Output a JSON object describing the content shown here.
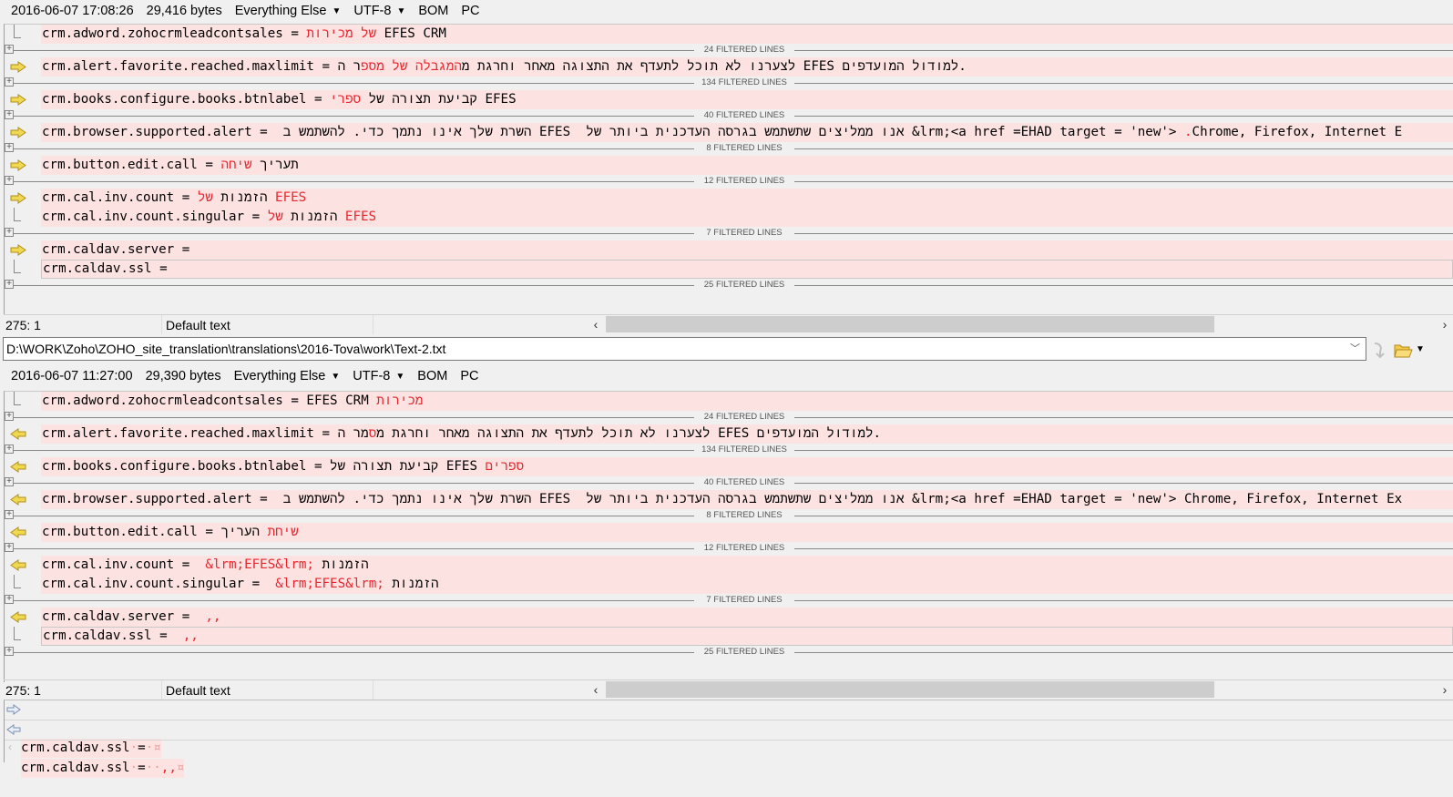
{
  "left_header": {
    "datetime": "2016-06-07 17:08:26",
    "size": "29,416 bytes",
    "format": "Everything Else",
    "encoding": "UTF-8",
    "bom": "BOM",
    "line_ending": "PC"
  },
  "left_panel": [
    {
      "type": "row",
      "arrow": false,
      "parts": [
        {
          "t": "crm.adword.zohocrmleadcontsales = "
        },
        {
          "t": "של מכירות",
          "red": true
        },
        {
          "t": " EFES CRM"
        }
      ]
    },
    {
      "type": "sep",
      "label": "24 FILTERED LINES"
    },
    {
      "type": "row",
      "arrow": true,
      "parts": [
        {
          "t": "crm.alert.favorite.reached.maxlimit = לצערנו לא תוכל לתעדף את התצוגה מאחר וחרגת מ"
        },
        {
          "t": "המגבלה של מספ",
          "red": true
        },
        {
          "t": "ר ה EFES למודול המועדפים."
        }
      ]
    },
    {
      "type": "sep",
      "label": "134 FILTERED LINES"
    },
    {
      "type": "row",
      "arrow": true,
      "parts": [
        {
          "t": "crm.books.configure.books.btnlabel = קביעת תצורה של "
        },
        {
          "t": "ספרי",
          "red": true
        },
        {
          "t": " EFES"
        }
      ]
    },
    {
      "type": "sep",
      "label": "40 FILTERED LINES"
    },
    {
      "type": "row",
      "arrow": true,
      "parts": [
        {
          "t": "crm.browser.supported.alert =  השרת שלך אינו נתמך כדי. להשתמש ב EFES  אנו ממליצים שתשתמש בגרסה העדכנית ביותר של &lrm;<a href =EHAD target = 'new'> "
        },
        {
          "t": ".",
          "red": true
        },
        {
          "t": "Chrome, Firefox, Internet E"
        }
      ]
    },
    {
      "type": "sep",
      "label": "8 FILTERED LINES"
    },
    {
      "type": "row",
      "arrow": true,
      "parts": [
        {
          "t": "crm.button.edit.call = תעריך "
        },
        {
          "t": "שיחה",
          "red": true
        }
      ]
    },
    {
      "type": "sep",
      "label": "12 FILTERED LINES"
    },
    {
      "type": "row",
      "arrow": true,
      "parts": [
        {
          "t": "crm.cal.inv.count = הזמנות "
        },
        {
          "t": "של EFES",
          "red": true
        }
      ]
    },
    {
      "type": "row",
      "arrow": false,
      "parts": [
        {
          "t": "crm.cal.inv.count.singular = הזמנות "
        },
        {
          "t": "של EFES",
          "red": true
        }
      ]
    },
    {
      "type": "sep",
      "label": "7 FILTERED LINES"
    },
    {
      "type": "row",
      "arrow": true,
      "parts": [
        {
          "t": "crm.caldav.server = "
        }
      ]
    },
    {
      "type": "row",
      "arrow": false,
      "boxed": true,
      "parts": [
        {
          "t": "crm.caldav.ssl = "
        }
      ]
    },
    {
      "type": "sep",
      "label": "25 FILTERED LINES"
    }
  ],
  "left_status": {
    "position": "275: 1",
    "syntax": "Default text"
  },
  "path": "D:\\WORK\\Zoho\\ZOHO_site_translation\\translations\\2016-Tova\\work\\Text-2.txt",
  "right_header": {
    "datetime": "2016-06-07 11:27:00",
    "size": "29,390 bytes",
    "format": "Everything Else",
    "encoding": "UTF-8",
    "bom": "BOM",
    "line_ending": "PC"
  },
  "right_panel": [
    {
      "type": "row",
      "arrow": false,
      "parts": [
        {
          "t": "crm.adword.zohocrmleadcontsales = EFES CRM "
        },
        {
          "t": "מכירות",
          "red": true
        }
      ]
    },
    {
      "type": "sep",
      "label": "24 FILTERED LINES"
    },
    {
      "type": "row",
      "arrow": true,
      "parts": [
        {
          "t": "crm.alert.favorite.reached.maxlimit = לצערנו לא תוכל לתעדף את התצוגה מאחר וחרגת מ"
        },
        {
          "t": "ס",
          "red": true
        },
        {
          "t": "מר ה EFES למודול המועדפים."
        }
      ]
    },
    {
      "type": "sep",
      "label": "134 FILTERED LINES"
    },
    {
      "type": "row",
      "arrow": true,
      "parts": [
        {
          "t": "crm.books.configure.books.btnlabel = קביעת תצורה של EFES "
        },
        {
          "t": "ספרים",
          "red": true
        }
      ]
    },
    {
      "type": "sep",
      "label": "40 FILTERED LINES"
    },
    {
      "type": "row",
      "arrow": true,
      "parts": [
        {
          "t": "crm.browser.supported.alert =  השרת שלך אינו נתמך כדי. להשתמש ב EFES  אנו ממליצים שתשתמש בגרסה העדכנית ביותר של &lrm;<a href =EHAD target = 'new'> Chrome, Firefox, Internet Ex"
        }
      ]
    },
    {
      "type": "sep",
      "label": "8 FILTERED LINES"
    },
    {
      "type": "row",
      "arrow": true,
      "parts": [
        {
          "t": "crm.button.edit.call = "
        },
        {
          "t": "שיחת",
          "red": true
        },
        {
          "t": " העריך"
        }
      ]
    },
    {
      "type": "sep",
      "label": "12 FILTERED LINES"
    },
    {
      "type": "row",
      "arrow": true,
      "parts": [
        {
          "t": "crm.cal.inv.count =  "
        },
        {
          "t": "&lrm;EFES&lrm;",
          "red": true
        },
        {
          "t": " הזמנות"
        }
      ]
    },
    {
      "type": "row",
      "arrow": false,
      "parts": [
        {
          "t": "crm.cal.inv.count.singular =  "
        },
        {
          "t": "&lrm;EFES&lrm;",
          "red": true
        },
        {
          "t": " הזמנות"
        }
      ]
    },
    {
      "type": "sep",
      "label": "7 FILTERED LINES"
    },
    {
      "type": "row",
      "arrow": true,
      "parts": [
        {
          "t": "crm.caldav.server =  "
        },
        {
          "t": ",,",
          "red": true
        }
      ]
    },
    {
      "type": "row",
      "arrow": false,
      "boxed": true,
      "parts": [
        {
          "t": "crm.caldav.ssl =  "
        },
        {
          "t": ",,",
          "red": true
        }
      ]
    },
    {
      "type": "sep",
      "label": "25 FILTERED LINES"
    }
  ],
  "right_status": {
    "position": "275: 1",
    "syntax": "Default text"
  },
  "detail": {
    "left_line": {
      "key": "crm.caldav.ssl",
      "sep": "=",
      "end": "¤"
    },
    "right_line": {
      "key": "crm.caldav.ssl",
      "sep": "=",
      "value": ",,",
      "end": "¤"
    }
  },
  "icons": {
    "left_arrow": "arrow-right-icon",
    "right_arrow": "arrow-left-icon",
    "arrow_color": "#f0d850",
    "diff_bg": "#fde2e2",
    "diff_text": "#e8262e"
  }
}
